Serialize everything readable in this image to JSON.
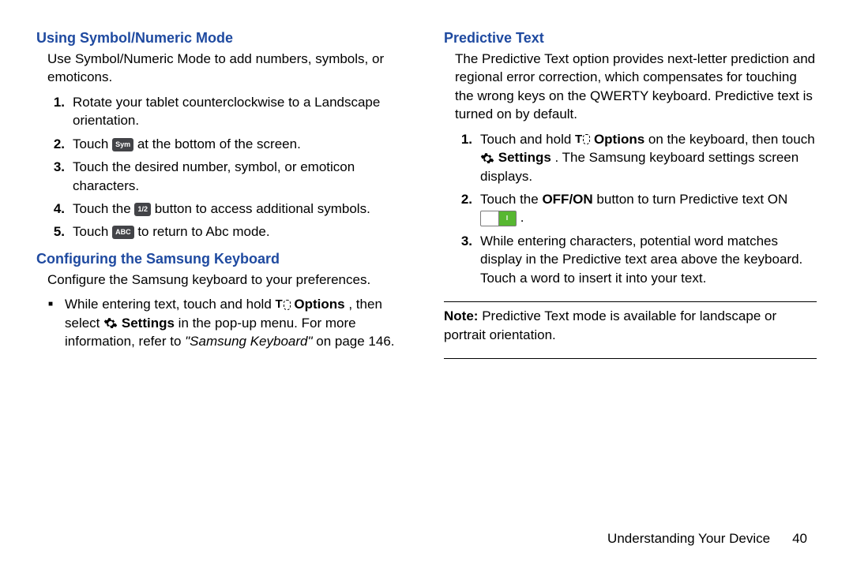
{
  "left": {
    "sec1": {
      "title": "Using Symbol/Numeric Mode",
      "intro": "Use Symbol/Numeric Mode to add numbers, symbols, or emoticons.",
      "steps": {
        "n1": "1.",
        "t1": "Rotate your tablet counterclockwise to a Landscape orientation.",
        "n2": "2.",
        "t2a": "Touch ",
        "icon2": "Sym",
        "t2b": " at the bottom of the screen.",
        "n3": "3.",
        "t3": "Touch the desired number, symbol, or emoticon characters.",
        "n4": "4.",
        "t4a": "Touch the ",
        "icon4": "1/2",
        "t4b": " button to access additional symbols.",
        "n5": "5.",
        "t5a": "Touch ",
        "icon5": "ABC",
        "t5b": " to return to Abc mode."
      }
    },
    "sec2": {
      "title": "Configuring the Samsung Keyboard",
      "intro": "Configure the Samsung keyboard to your preferences.",
      "b1a": "While entering text, touch and hold ",
      "b1opt": " Options",
      "b1b": ", then select ",
      "b1set": " Settings",
      "b1c": " in the pop-up menu. ",
      "b1d": "For more information, refer to ",
      "b1ref": "\"Samsung Keyboard\"",
      "b1e": " on page 146."
    }
  },
  "right": {
    "sec1": {
      "title": "Predictive Text",
      "intro": "The Predictive Text option provides next-letter prediction and regional error correction, which compensates for touching the wrong keys on the QWERTY keyboard. Predictive text is turned on by default.",
      "steps": {
        "n1": "1.",
        "t1a": "Touch and hold ",
        "t1opt": " Options",
        "t1b": " on the keyboard, then touch ",
        "t1set": " Settings",
        "t1c": ". The Samsung keyboard settings screen displays.",
        "n2": "2.",
        "t2a": "Touch the ",
        "t2b": "OFF/ON",
        "t2c": " button to turn Predictive text ON ",
        "t2d": ".",
        "n3": "3.",
        "t3": "While entering characters, potential word matches display in the Predictive text area above the keyboard. Touch a word to insert it into your text."
      }
    },
    "note": {
      "lead": "Note:",
      "body": " Predictive Text mode is available for landscape or portrait orientation."
    }
  },
  "footer": {
    "section": "Understanding Your Device",
    "page": "40"
  }
}
